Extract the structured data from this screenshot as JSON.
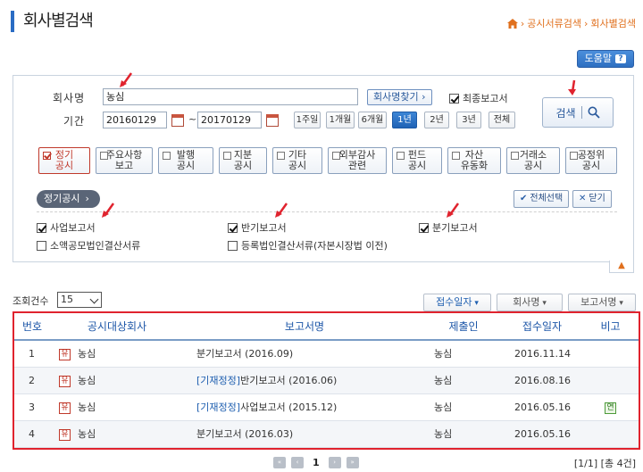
{
  "header": {
    "title": "회사별검색",
    "breadcrumb": [
      "공시서류검색",
      "회사별검색"
    ]
  },
  "help_label": "도움말",
  "form": {
    "company_label": "회사명",
    "company_value": "농심",
    "company_find_btn": "회사명찾기 ›",
    "latest_report_label": "최종보고서",
    "period_label": "기간",
    "date_from": "20160129",
    "date_sep": "~",
    "date_to": "20170129",
    "period_buttons": [
      "1주일",
      "1개월",
      "6개월",
      "1년",
      "2년",
      "3년",
      "전체"
    ],
    "period_active": "1년",
    "search_btn": "검색"
  },
  "categories": [
    {
      "line1": "정기",
      "line2": "공시",
      "checked": true
    },
    {
      "line1": "주요사항",
      "line2": "보고",
      "checked": false
    },
    {
      "line1": "발행",
      "line2": "공시",
      "checked": false
    },
    {
      "line1": "지분",
      "line2": "공시",
      "checked": false
    },
    {
      "line1": "기타",
      "line2": "공시",
      "checked": false
    },
    {
      "line1": "외부감사",
      "line2": "관련",
      "checked": false
    },
    {
      "line1": "펀드",
      "line2": "공시",
      "checked": false
    },
    {
      "line1": "자산",
      "line2": "유동화",
      "checked": false
    },
    {
      "line1": "거래소",
      "line2": "공시",
      "checked": false
    },
    {
      "line1": "공정위",
      "line2": "공시",
      "checked": false
    }
  ],
  "sub": {
    "tag": "정기공시",
    "select_all": "전체선택",
    "close": "닫기",
    "options": [
      {
        "label": "사업보고서",
        "checked": true
      },
      {
        "label": "반기보고서",
        "checked": true
      },
      {
        "label": "분기보고서",
        "checked": true
      },
      {
        "label": "소액공모법인결산서류",
        "checked": false
      },
      {
        "label": "등록법인결산서류(자본시장법 이전)",
        "checked": false
      }
    ]
  },
  "list": {
    "count_label": "조회건수",
    "count_value": "15",
    "sort_buttons": [
      "접수일자",
      "회사명",
      "보고서명"
    ],
    "columns": [
      "번호",
      "공시대상회사",
      "보고서명",
      "제출인",
      "접수일자",
      "비고"
    ],
    "rows": [
      {
        "no": "1",
        "badge": "유",
        "company": "농심",
        "prefix": "",
        "report": "분기보고서 (2016.09)",
        "submitter": "농심",
        "date": "2016.11.14",
        "note": ""
      },
      {
        "no": "2",
        "badge": "유",
        "company": "농심",
        "prefix": "[기재정정]",
        "report": "반기보고서 (2016.06)",
        "submitter": "농심",
        "date": "2016.08.16",
        "note": ""
      },
      {
        "no": "3",
        "badge": "유",
        "company": "농심",
        "prefix": "[기재정정]",
        "report": "사업보고서 (2015.12)",
        "submitter": "농심",
        "date": "2016.05.16",
        "note": "연"
      },
      {
        "no": "4",
        "badge": "유",
        "company": "농심",
        "prefix": "",
        "report": "분기보고서 (2016.03)",
        "submitter": "농심",
        "date": "2016.05.16",
        "note": ""
      }
    ],
    "current_page": "1",
    "page_info": "[1/1] [총 4건]"
  }
}
